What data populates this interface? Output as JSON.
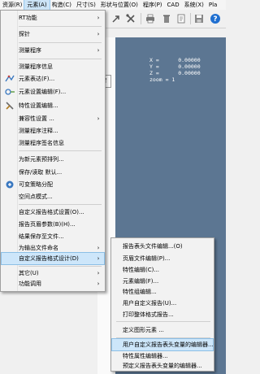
{
  "menubar": {
    "items": [
      "资源(R)",
      "元素(A)",
      "构造(C)",
      "尺寸(S)",
      "形状与位置(O)",
      "程序(P)",
      "CAD",
      "系统(X)",
      "Pla"
    ],
    "active_index": 1
  },
  "readout": {
    "x": "X =      0.00000",
    "y": "Y =      0.00000",
    "z": "Z =      0.00000",
    "zoom": "zoom = 1"
  },
  "side_tab_label": "⇑",
  "menu": {
    "items": [
      {
        "label": "RT功能",
        "arrow": "›",
        "icon": ""
      },
      {
        "label": "探针",
        "arrow": "›",
        "icon": ""
      },
      {
        "label": "测量程序",
        "arrow": "›",
        "icon": ""
      },
      {
        "label": "测量程序信息",
        "arrow": "",
        "icon": ""
      },
      {
        "label": "元素表达(F)...",
        "arrow": "",
        "icon": "feature-expression-icon"
      },
      {
        "label": "元素设置编辑(F)...",
        "arrow": "",
        "icon": "feature-settings-icon"
      },
      {
        "label": "特性设置编辑...",
        "arrow": "",
        "icon": "characteristic-settings-icon"
      },
      {
        "label": "兼容性设置 ...",
        "arrow": "›",
        "icon": ""
      },
      {
        "label": "测量程序注释...",
        "arrow": "",
        "icon": ""
      },
      {
        "label": "测量程序签名信息",
        "arrow": "",
        "icon": ""
      },
      {
        "label": "为新元素预排列...",
        "arrow": "",
        "icon": ""
      },
      {
        "label": "保存/读取 默认...",
        "arrow": "",
        "icon": ""
      },
      {
        "label": "可变策略分配",
        "arrow": "",
        "icon": "variable-strategy-icon"
      },
      {
        "label": "空间点模式...",
        "arrow": "",
        "icon": ""
      },
      {
        "label": "自定义报告格式设置(O)...",
        "arrow": "",
        "icon": ""
      },
      {
        "label": "报告页眉参数(B)(H)...",
        "arrow": "",
        "icon": ""
      },
      {
        "label": "结果保存至文件...",
        "arrow": "",
        "icon": ""
      },
      {
        "label": "为输出文件命名",
        "arrow": "›",
        "icon": ""
      },
      {
        "label": "自定义报告格式设计(D)",
        "arrow": "›",
        "icon": ""
      },
      {
        "label": "其它(U)",
        "arrow": "›",
        "icon": ""
      },
      {
        "label": "功能调用",
        "arrow": "›",
        "icon": ""
      }
    ]
  },
  "submenu": {
    "items": [
      {
        "label": "报告表头文件编辑...(O)"
      },
      {
        "label": "页眉文件编辑(P)..."
      },
      {
        "label": "特性编辑(C)..."
      },
      {
        "label": "元素编辑(F)..."
      },
      {
        "label": "特性组编辑..."
      },
      {
        "label": "用户自定义报告(U)..."
      },
      {
        "label": "打印整体格式报告..."
      },
      {
        "label": "定义图形元素 ..."
      },
      {
        "label": "用户自定义报告表头变量的编辑器..."
      },
      {
        "label": "特性属性编辑器..."
      },
      {
        "label": "预定义报告表头变量的编辑器..."
      }
    ]
  },
  "colors": {
    "canvas": "#5c7692",
    "highlight": "#cde6fa",
    "help_blue": "#1f6fd0"
  }
}
